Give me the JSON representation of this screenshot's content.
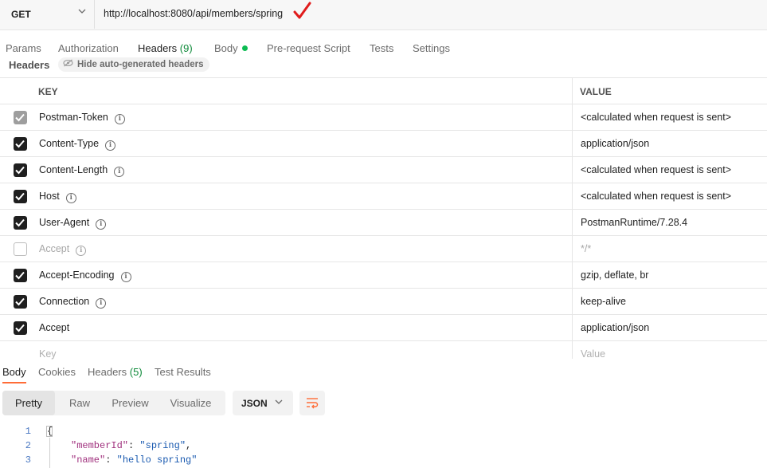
{
  "request": {
    "method": "GET",
    "url": "http://localhost:8080/api/members/spring"
  },
  "request_tabs": {
    "params": "Params",
    "authorization": "Authorization",
    "headers": "Headers",
    "headers_count": "(9)",
    "body": "Body",
    "pre_request": "Pre-request Script",
    "tests": "Tests",
    "settings": "Settings"
  },
  "headers_section": {
    "title": "Headers",
    "hide_button": "Hide auto-generated headers"
  },
  "headers_table": {
    "columns": {
      "key": "KEY",
      "value": "VALUE"
    },
    "rows": [
      {
        "key": "Postman-Token",
        "value": "<calculated when request is sent>",
        "checked": true,
        "auto": true,
        "info": true
      },
      {
        "key": "Content-Type",
        "value": "application/json",
        "checked": true,
        "auto": false,
        "info": true
      },
      {
        "key": "Content-Length",
        "value": "<calculated when request is sent>",
        "checked": true,
        "auto": false,
        "info": true
      },
      {
        "key": "Host",
        "value": "<calculated when request is sent>",
        "checked": true,
        "auto": false,
        "info": true
      },
      {
        "key": "User-Agent",
        "value": "PostmanRuntime/7.28.4",
        "checked": true,
        "auto": false,
        "info": true
      },
      {
        "key": "Accept",
        "value": "*/*",
        "checked": false,
        "auto": false,
        "info": true
      },
      {
        "key": "Accept-Encoding",
        "value": "gzip, deflate, br",
        "checked": true,
        "auto": false,
        "info": true
      },
      {
        "key": "Connection",
        "value": "keep-alive",
        "checked": true,
        "auto": false,
        "info": true
      },
      {
        "key": "Accept",
        "value": "application/json",
        "checked": true,
        "auto": false,
        "info": false
      }
    ],
    "new_row": {
      "key_placeholder": "Key",
      "value_placeholder": "Value"
    }
  },
  "response_tabs": {
    "body": "Body",
    "cookies": "Cookies",
    "headers": "Headers",
    "headers_count": "(5)",
    "test_results": "Test Results"
  },
  "response_toolbar": {
    "views": [
      "Pretty",
      "Raw",
      "Preview",
      "Visualize"
    ],
    "active_view": "Pretty",
    "format": "JSON",
    "wrap_icon": "wrap-lines-icon"
  },
  "response_body": {
    "line_numbers": [
      "1",
      "2",
      "3"
    ],
    "open_brace": "{",
    "lines": [
      {
        "key": "\"memberId\"",
        "sep": ": ",
        "value": "\"spring\"",
        "trail": ","
      },
      {
        "key": "\"name\"",
        "sep": ": ",
        "value": "\"hello spring\"",
        "trail": ""
      }
    ]
  },
  "colors": {
    "accent": "#ff6c37",
    "status_green": "#0cbb52",
    "checkmark_red": "#e01b1b"
  }
}
